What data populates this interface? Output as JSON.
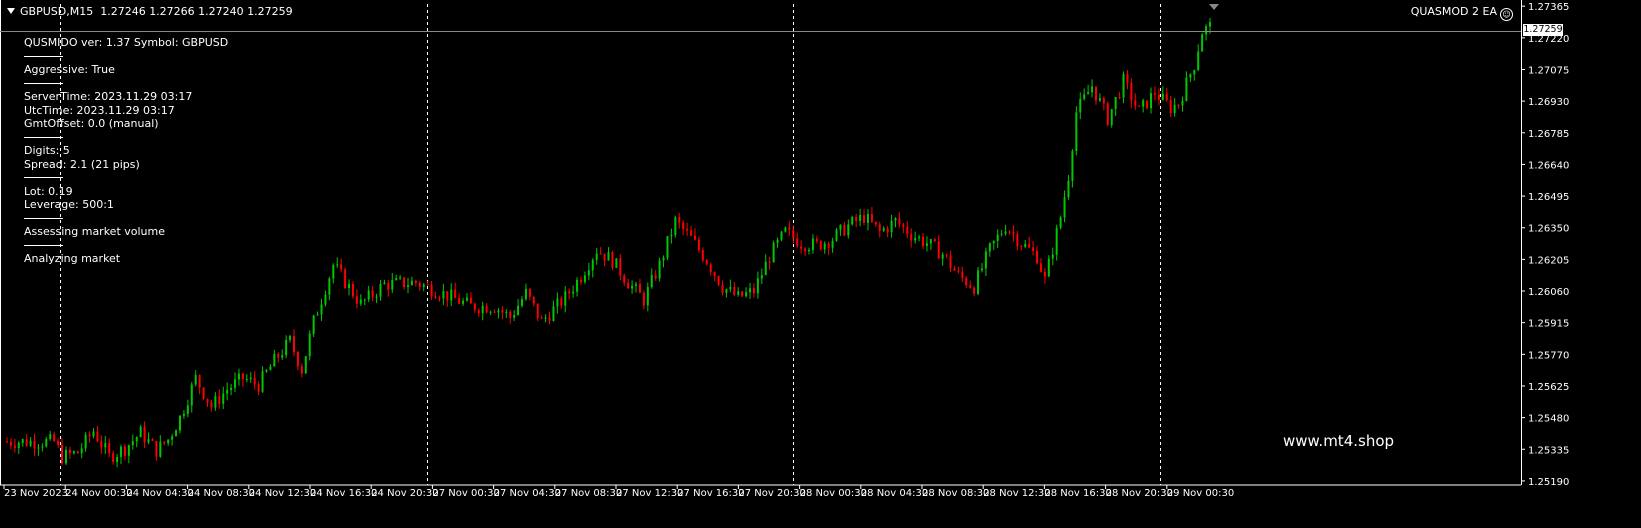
{
  "header": {
    "symbol": "GBPUSD,M15",
    "ohlc": "1.27246 1.27266 1.27240 1.27259",
    "ea_name": "QUASMOD 2 EA",
    "ea_icon": "smiley-icon"
  },
  "info_panel": [
    {
      "type": "text",
      "label": "QUSMIDO ver: 1.37 Symbol: GBPUSD"
    },
    {
      "type": "sep"
    },
    {
      "type": "text",
      "label": "Aggressive: True"
    },
    {
      "type": "sep"
    },
    {
      "type": "text",
      "label": "ServerTime: 2023.11.29 03:17"
    },
    {
      "type": "text",
      "label": "UtcTime: 2023.11.29 03:17"
    },
    {
      "type": "text",
      "label": "GmtOffset: 0.0 (manual)"
    },
    {
      "type": "sep"
    },
    {
      "type": "text",
      "label": "Digits: 5"
    },
    {
      "type": "text",
      "label": "Spread: 2.1 (21 pips)"
    },
    {
      "type": "sep"
    },
    {
      "type": "text",
      "label": "Lot: 0.19"
    },
    {
      "type": "text",
      "label": "Leverage: 500:1"
    },
    {
      "type": "sep"
    },
    {
      "type": "text",
      "label": "Assessing market volume"
    },
    {
      "type": "sep"
    },
    {
      "type": "text",
      "label": "Analyzing market"
    }
  ],
  "watermark": "www.mt4.shop",
  "current_price": "1.27259",
  "colors": {
    "background": "#000000",
    "bull": "#00c800",
    "bear": "#ff0000",
    "grid_separator": "#ffffff",
    "text": "#ffffff"
  },
  "chart_data": {
    "type": "candlestick",
    "symbol": "GBPUSD",
    "timeframe": "M15",
    "price_ticks": [
      "1.27365",
      "1.27220",
      "1.27075",
      "1.26930",
      "1.26785",
      "1.26640",
      "1.26495",
      "1.26350",
      "1.26205",
      "1.26060",
      "1.25915",
      "1.25770",
      "1.25625",
      "1.25480",
      "1.25335",
      "1.25190"
    ],
    "ylim": [
      1.25185,
      1.27375
    ],
    "time_labels": [
      "23 Nov 2023",
      "24 Nov 00:30",
      "24 Nov 04:30",
      "24 Nov 08:30",
      "24 Nov 12:30",
      "24 Nov 16:30",
      "24 Nov 20:30",
      "27 Nov 00:30",
      "27 Nov 04:30",
      "27 Nov 08:30",
      "27 Nov 12:30",
      "27 Nov 16:30",
      "27 Nov 20:30",
      "28 Nov 00:30",
      "28 Nov 04:30",
      "28 Nov 08:30",
      "28 Nov 12:30",
      "28 Nov 16:30",
      "28 Nov 20:30",
      "29 Nov 00:30"
    ],
    "day_separators": [
      "24 Nov 2023",
      "27 Nov 2023",
      "28 Nov 2023",
      "29 Nov 2023"
    ],
    "price_path": [
      [
        0,
        1.2537
      ],
      [
        12,
        1.2537
      ],
      [
        14,
        1.253
      ],
      [
        18,
        1.2532
      ],
      [
        22,
        1.2542
      ],
      [
        26,
        1.253
      ],
      [
        30,
        1.2534
      ],
      [
        34,
        1.2541
      ],
      [
        38,
        1.2533
      ],
      [
        41,
        1.2538
      ],
      [
        44,
        1.2548
      ],
      [
        48,
        1.2566
      ],
      [
        52,
        1.2553
      ],
      [
        56,
        1.2561
      ],
      [
        60,
        1.2566
      ],
      [
        64,
        1.2563
      ],
      [
        68,
        1.2574
      ],
      [
        72,
        1.2583
      ],
      [
        75,
        1.257
      ],
      [
        78,
        1.2592
      ],
      [
        83,
        1.2618
      ],
      [
        90,
        1.26
      ],
      [
        96,
        1.2609
      ],
      [
        104,
        1.261
      ],
      [
        112,
        1.2604
      ],
      [
        118,
        1.2599
      ],
      [
        124,
        1.2599
      ],
      [
        128,
        1.2594
      ],
      [
        132,
        1.2605
      ],
      [
        136,
        1.2592
      ],
      [
        142,
        1.2603
      ],
      [
        146,
        1.2613
      ],
      [
        150,
        1.2625
      ],
      [
        154,
        1.262
      ],
      [
        158,
        1.261
      ],
      [
        162,
        1.2602
      ],
      [
        166,
        1.2618
      ],
      [
        170,
        1.2638
      ],
      [
        174,
        1.263
      ],
      [
        178,
        1.262
      ],
      [
        182,
        1.2608
      ],
      [
        186,
        1.2603
      ],
      [
        190,
        1.2606
      ],
      [
        194,
        1.2622
      ],
      [
        198,
        1.2633
      ],
      [
        202,
        1.2628
      ],
      [
        206,
        1.2627
      ],
      [
        210,
        1.263
      ],
      [
        214,
        1.2636
      ],
      [
        218,
        1.264
      ],
      [
        222,
        1.2633
      ],
      [
        226,
        1.2638
      ],
      [
        230,
        1.2632
      ],
      [
        234,
        1.2628
      ],
      [
        238,
        1.2623
      ],
      [
        242,
        1.2613
      ],
      [
        246,
        1.2608
      ],
      [
        250,
        1.2625
      ],
      [
        254,
        1.2636
      ],
      [
        258,
        1.2628
      ],
      [
        262,
        1.2622
      ],
      [
        264,
        1.2611
      ],
      [
        268,
        1.264
      ],
      [
        270,
        1.2659
      ],
      [
        272,
        1.2688
      ],
      [
        276,
        1.27
      ],
      [
        280,
        1.2685
      ],
      [
        284,
        1.2702
      ],
      [
        288,
        1.2688
      ],
      [
        292,
        1.2697
      ],
      [
        296,
        1.269
      ],
      [
        298,
        1.2692
      ],
      [
        302,
        1.271
      ],
      [
        304,
        1.2725
      ],
      [
        306,
        1.2727
      ]
    ]
  }
}
